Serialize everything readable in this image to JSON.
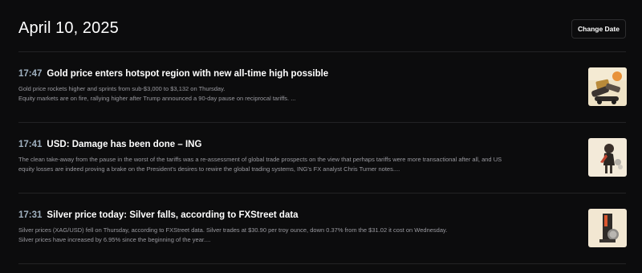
{
  "header": {
    "date": "April 10, 2025",
    "change_date_label": "Change Date"
  },
  "articles": [
    {
      "time": "17:47",
      "title": "Gold price enters hotspot region with new all-time high possible",
      "summary": [
        "Gold price rockets higher and sprints from sub-$3,000 to $3,132 on Thursday.",
        "Equity markets are on fire, rallying higher after Trump announced a 90-day pause on reciprocal tariffs. ..."
      ],
      "thumb_icon": "gold-price-thumbnail"
    },
    {
      "time": "17:41",
      "title": "USD: Damage has been done – ING",
      "summary": [
        "The clean take-away from the pause in the worst of the tariffs was a re-assessment of global trade prospects on the view that perhaps tariffs were more transactional after all, and US",
        "equity losses are indeed proving a brake on the President's desires to rewire the global trading systems, ING's FX analyst Chris Turner notes...."
      ],
      "thumb_icon": "usd-figure-thumbnail"
    },
    {
      "time": "17:31",
      "title": "Silver price today: Silver falls, according to FXStreet data",
      "summary": [
        "Silver prices (XAG/USD) fell on Thursday, according to FXStreet data. Silver trades at $30.90 per troy ounce, down 0.37% from the $31.02 it cost on Wednesday.",
        "Silver prices have increased by 6.95% since the beginning of the year...."
      ],
      "thumb_icon": "silver-price-thumbnail"
    }
  ]
}
